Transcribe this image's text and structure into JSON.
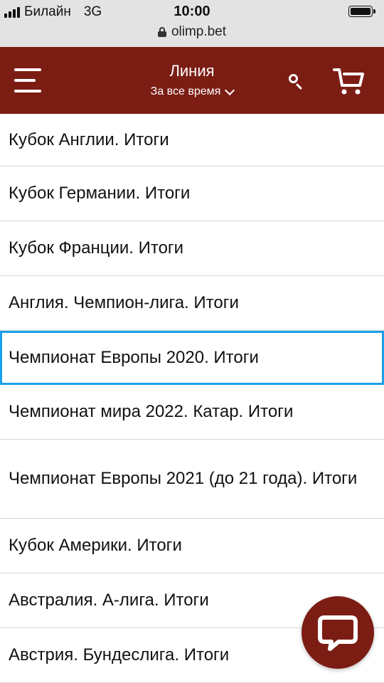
{
  "status_bar": {
    "carrier": "Билайн",
    "network": "3G",
    "time": "10:00",
    "url": "olimp.bet"
  },
  "header": {
    "title": "Линия",
    "filter_label": "За все время",
    "background_color": "#7c1d14"
  },
  "icons": {
    "menu": "menu-icon",
    "search": "search-icon",
    "cart": "cart-icon",
    "chat": "chat-icon",
    "lock": "lock-icon"
  },
  "list": {
    "selected_index": 4,
    "selection_color": "#1aa0ee",
    "items": [
      {
        "label": "Кубок Англии. Итоги"
      },
      {
        "label": "Кубок Германии. Итоги"
      },
      {
        "label": "Кубок Франции. Итоги"
      },
      {
        "label": "Англия. Чемпион-лига. Итоги"
      },
      {
        "label": "Чемпионат Европы 2020. Итоги"
      },
      {
        "label": "Чемпионат мира 2022. Катар. Итоги"
      },
      {
        "label": "Чемпионат Европы 2021 (до 21 года). Итоги"
      },
      {
        "label": "Кубок Америки. Итоги"
      },
      {
        "label": "Австралия. А-лига. Итоги"
      },
      {
        "label": "Австрия. Бундеслига. Итоги"
      }
    ]
  }
}
